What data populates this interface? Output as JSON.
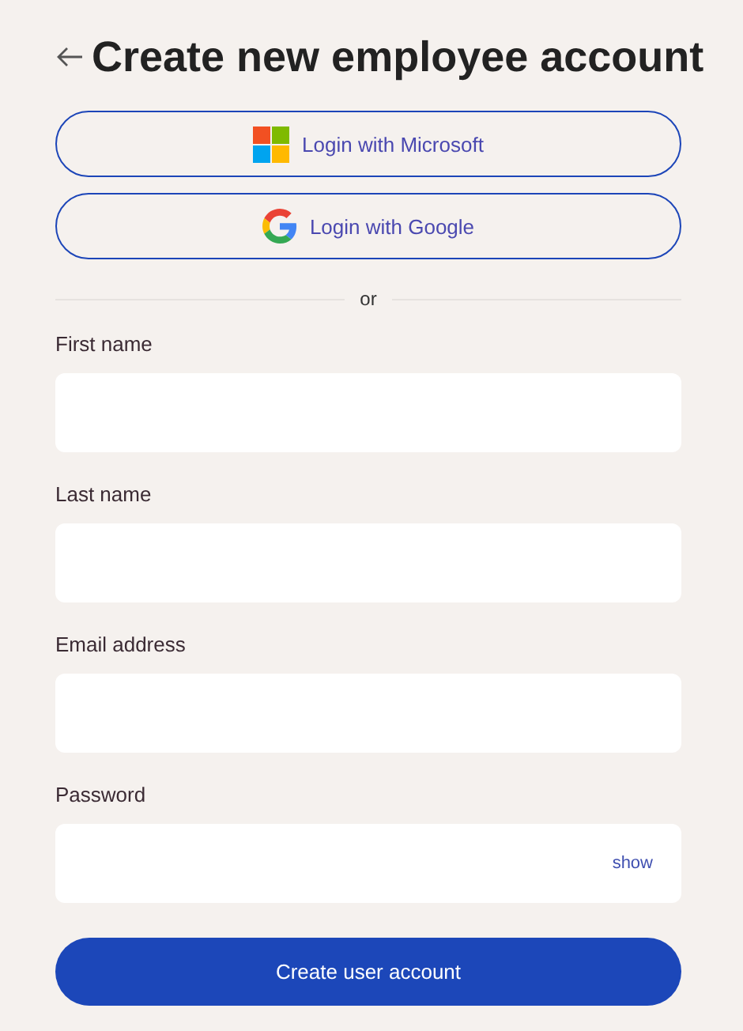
{
  "header": {
    "title": "Create new employee account"
  },
  "sso_buttons": [
    {
      "kind": "microsoft",
      "label": "Login with Microsoft"
    },
    {
      "kind": "google",
      "label": "Login with Google"
    }
  ],
  "divider": {
    "label": "or"
  },
  "fields": [
    {
      "kind": "text",
      "label": "First name"
    },
    {
      "kind": "text",
      "label": "Last name"
    },
    {
      "kind": "text",
      "label": "Email address"
    },
    {
      "kind": "password",
      "label": "Password",
      "toggle": "show"
    }
  ],
  "submit": {
    "label": "Create user account"
  }
}
